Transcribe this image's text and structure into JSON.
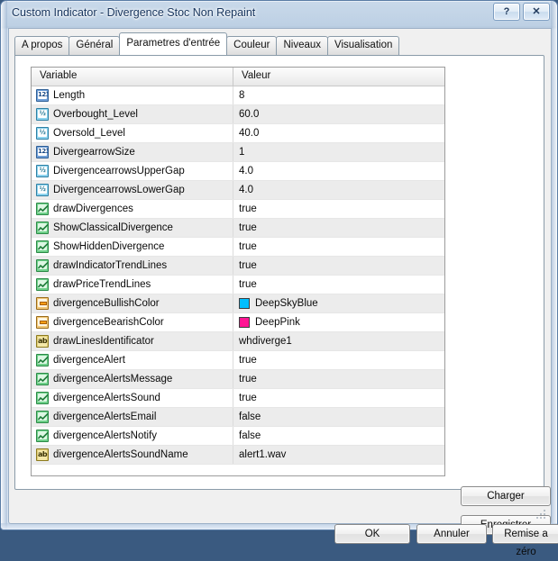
{
  "window": {
    "title": "Custom Indicator - Divergence Stoc Non Repaint",
    "help_glyph": "?",
    "close_glyph": "✕"
  },
  "tabs": [
    {
      "label": "A propos",
      "selected": false
    },
    {
      "label": "Général",
      "selected": false
    },
    {
      "label": "Parametres d'entrée",
      "selected": true
    },
    {
      "label": "Couleur",
      "selected": false
    },
    {
      "label": "Niveaux",
      "selected": false
    },
    {
      "label": "Visualisation",
      "selected": false
    }
  ],
  "grid": {
    "headers": {
      "variable": "Variable",
      "valeur": "Valeur"
    },
    "rows": [
      {
        "icon": "int-icon",
        "type": "int",
        "name": "Length",
        "value": "8"
      },
      {
        "icon": "double-icon",
        "type": "dbl",
        "name": "Overbought_Level",
        "value": "60.0"
      },
      {
        "icon": "double-icon",
        "type": "dbl",
        "name": "Oversold_Level",
        "value": "40.0"
      },
      {
        "icon": "int-icon",
        "type": "int",
        "name": "DivergearrowSize",
        "value": "1"
      },
      {
        "icon": "double-icon",
        "type": "dbl",
        "name": "DivergencearrowsUpperGap",
        "value": "4.0"
      },
      {
        "icon": "double-icon",
        "type": "dbl",
        "name": "DivergencearrowsLowerGap",
        "value": "4.0"
      },
      {
        "icon": "bool-icon",
        "type": "bool",
        "name": "drawDivergences",
        "value": "true"
      },
      {
        "icon": "bool-icon",
        "type": "bool",
        "name": "ShowClassicalDivergence",
        "value": "true"
      },
      {
        "icon": "bool-icon",
        "type": "bool",
        "name": "ShowHiddenDivergence",
        "value": "true"
      },
      {
        "icon": "bool-icon",
        "type": "bool",
        "name": "drawIndicatorTrendLines",
        "value": "true"
      },
      {
        "icon": "bool-icon",
        "type": "bool",
        "name": "drawPriceTrendLines",
        "value": "true"
      },
      {
        "icon": "color-icon",
        "type": "color",
        "name": "divergenceBullishColor",
        "value": "DeepSkyBlue",
        "swatch": "#00BFFF"
      },
      {
        "icon": "color-icon",
        "type": "color",
        "name": "divergenceBearishColor",
        "value": "DeepPink",
        "swatch": "#FF1493"
      },
      {
        "icon": "string-icon",
        "type": "str",
        "name": "drawLinesIdentificator",
        "value": "whdiverge1"
      },
      {
        "icon": "bool-icon",
        "type": "bool",
        "name": "divergenceAlert",
        "value": "true"
      },
      {
        "icon": "bool-icon",
        "type": "bool",
        "name": "divergenceAlertsMessage",
        "value": "true"
      },
      {
        "icon": "bool-icon",
        "type": "bool",
        "name": "divergenceAlertsSound",
        "value": "true"
      },
      {
        "icon": "bool-icon",
        "type": "bool",
        "name": "divergenceAlertsEmail",
        "value": "false"
      },
      {
        "icon": "bool-icon",
        "type": "bool",
        "name": "divergenceAlertsNotify",
        "value": "false"
      },
      {
        "icon": "string-icon",
        "type": "str",
        "name": "divergenceAlertsSoundName",
        "value": "alert1.wav"
      }
    ]
  },
  "side_buttons": {
    "charger": "Charger",
    "enregistrer": "Enregistrer"
  },
  "footer": {
    "ok": "OK",
    "annuler": "Annuler",
    "reset": "Remise a zéro"
  },
  "colors": {
    "deep_sky_blue": "#00BFFF",
    "deep_pink": "#FF1493",
    "titlebar_text": "#15335c",
    "row_alt": "#ececec"
  }
}
